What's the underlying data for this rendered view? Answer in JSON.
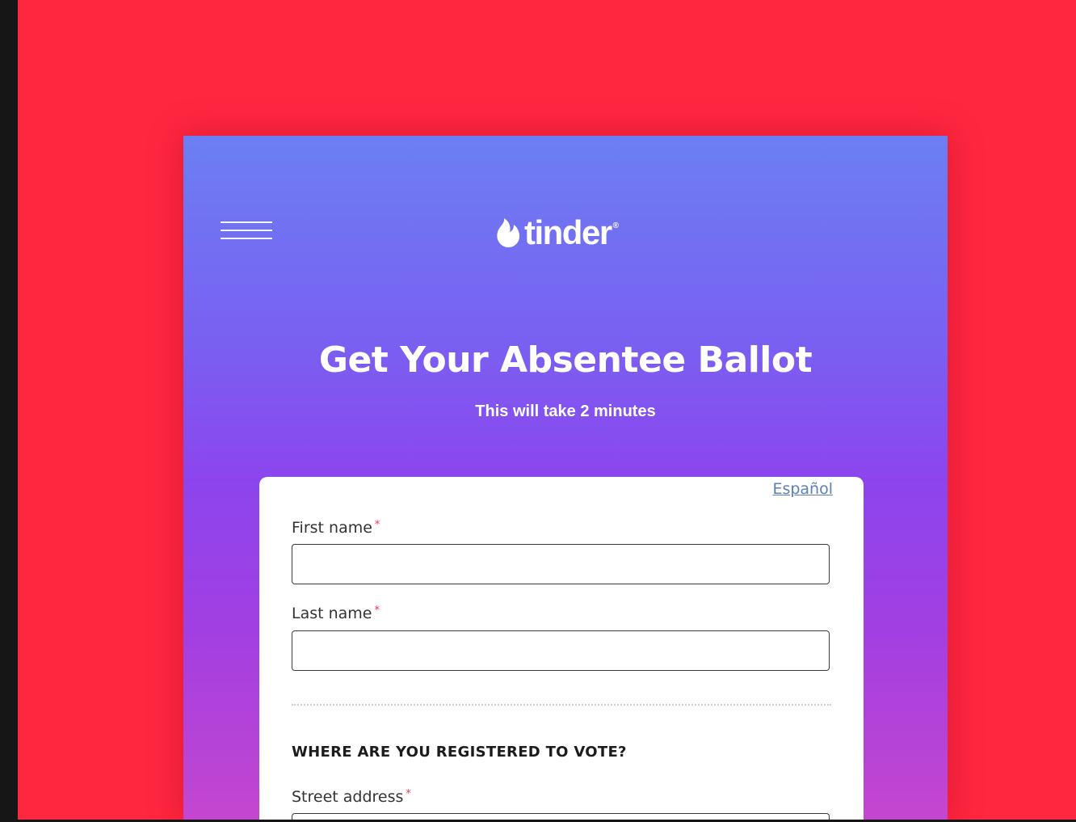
{
  "page": {
    "background_color": "#ff2640",
    "header": {
      "menu_icon": "hamburger-menu-icon",
      "brand_icon": "flame-icon",
      "brand_name": "tinder",
      "brand_mark": "®"
    },
    "hero": {
      "title": "Get Your Absentee Ballot",
      "subtitle": "This will take 2 minutes"
    },
    "form": {
      "language_link": "Español",
      "fields": [
        {
          "label": "First name",
          "required_mark": "*",
          "value": ""
        },
        {
          "label": "Last name",
          "required_mark": "*",
          "value": ""
        }
      ],
      "section_heading": "WHERE ARE YOU REGISTERED TO VOTE?",
      "street_address": {
        "label": "Street address",
        "required_mark": "*",
        "value": ""
      }
    }
  }
}
